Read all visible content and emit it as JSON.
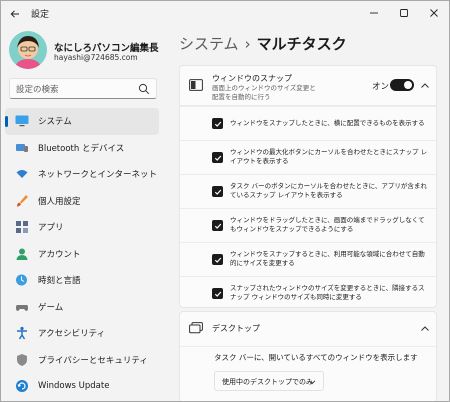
{
  "window": {
    "title": "設定"
  },
  "profile": {
    "name": "なにしろパソコン編集長",
    "email": "hayashi@724685.com"
  },
  "search": {
    "placeholder": "設定の検索"
  },
  "sidebar": {
    "items": [
      {
        "label": "システム",
        "icon": "display-icon",
        "active": true
      },
      {
        "label": "Bluetooth とデバイス",
        "icon": "bluetooth-icon"
      },
      {
        "label": "ネットワークとインターネット",
        "icon": "wifi-icon"
      },
      {
        "label": "個人用設定",
        "icon": "paintbrush-icon"
      },
      {
        "label": "アプリ",
        "icon": "apps-icon"
      },
      {
        "label": "アカウント",
        "icon": "person-icon"
      },
      {
        "label": "時刻と言語",
        "icon": "globe-clock-icon"
      },
      {
        "label": "ゲーム",
        "icon": "gamepad-icon"
      },
      {
        "label": "アクセシビリティ",
        "icon": "accessibility-icon"
      },
      {
        "label": "プライバシーとセキュリティ",
        "icon": "shield-icon"
      },
      {
        "label": "Windows Update",
        "icon": "update-icon"
      }
    ]
  },
  "header": {
    "parent": "システム",
    "separator": "›",
    "current": "マルチタスク"
  },
  "snap": {
    "title": "ウィンドウのスナップ",
    "description": "画面上のウィンドウのサイズ変更と配置を自動的に行う",
    "toggle_label": "オン",
    "toggle_on": true,
    "options": [
      {
        "text": "ウィンドウをスナップしたときに、横に配置できるものを表示する",
        "checked": true
      },
      {
        "text": "ウィンドウの最大化ボタンにカーソルを合わせたときにスナップ レイアウトを表示する",
        "checked": true
      },
      {
        "text": "タスク バーのボタンにカーソルを合わせたときに、アプリが含まれているスナップ レイアウトを表示する",
        "checked": true
      },
      {
        "text": "ウィンドウをドラッグしたときに、画面の端までドラッグしなくてもウィンドウをスナップできるようにする",
        "checked": true
      },
      {
        "text": "ウィンドウをスナップするときに、利用可能な領域に合わせて自動的にサイズを変更する",
        "checked": true
      },
      {
        "text": "スナップされたウィンドウのサイズを変更するときに、隣接するスナップ ウィンドウのサイズも同時に変更する",
        "checked": true
      }
    ]
  },
  "desktops": {
    "title": "デスクトップ",
    "taskbar_label": "タスク バーに、開いているすべてのウィンドウを表示します",
    "dropdown_value": "使用中のデスクトップでのみ"
  },
  "colors": {
    "accent": "#005fb8",
    "window_bg": "#f3f3f3",
    "card_bg": "#fbfbfb",
    "toggle_on": "#1b1b1b"
  }
}
